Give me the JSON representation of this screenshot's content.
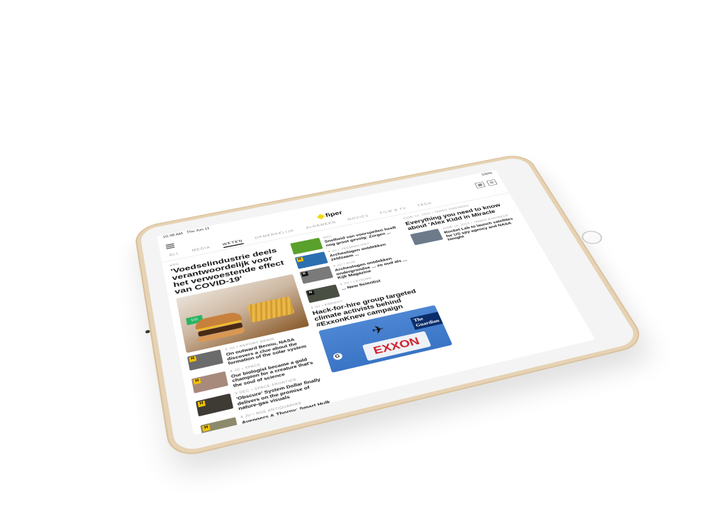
{
  "status": {
    "time": "10:38 AM",
    "date": "Thu Jun 11",
    "battery": "100%"
  },
  "app": {
    "name": "fiper"
  },
  "tabs": [
    {
      "label": "ALL"
    },
    {
      "label": "MEDIA"
    },
    {
      "label": "WETEN",
      "active": true
    },
    {
      "label": "OPMERKELIJK"
    },
    {
      "label": "ALGEMEEN"
    },
    {
      "label": "MOVIES"
    },
    {
      "label": "FILM & TV"
    },
    {
      "label": "TECH"
    }
  ],
  "col1": {
    "featured": {
      "meta": "NRC",
      "headline": "'Voedselindustrie deels verantwoordelijk voor het verwoestende effect van COVID-19'",
      "image": "burger-and-fries-photo"
    },
    "items": [
      {
        "meta": "3 JU • REPORT BRAIN",
        "title": "On outward Bennu, NASA discovers a clue about the formation of the solar system"
      },
      {
        "meta": "4 JU • SPACE",
        "title": "Our biologist became a gold champion for a creature that's the soul of science"
      },
      {
        "meta": "3 DEC • SPACE FRONTIER",
        "title": "'Obscure' System Dollar finally delivers on the promise of nature-gas visuals"
      },
      {
        "meta": "4 JU • NGE ANTIQUARIAN",
        "title": "Avengers & Thorpy: Smart Hulk came up on troubled Cleandia stones"
      }
    ]
  },
  "col2": {
    "items": [
      {
        "meta": "NRC",
        "title": "Snelheid van voorspellen heeft nog groot gevolg: Zorgen ..."
      },
      {
        "meta": "4 JU • TECHNOLOGY",
        "title": "Archeologen ontdekken zeldzaam ..."
      },
      {
        "meta": "4 JU • KIJK",
        "title": "Archeologen ontdekken ondergrondse ... zo oud als ... Kijk Magazine"
      },
      {
        "meta": "4 JU • LEISURE",
        "title": "... New Scientist"
      }
    ],
    "feature": {
      "meta": "4 JU • ENERGY",
      "headline": "Hack-for-hire group targeted climate activists behind #ExxonKnew campaign",
      "source_logo": "The Guardian",
      "sign_text": "EXXON"
    }
  },
  "col3": {
    "meta": "JUNE 10, 2016 • TAMER ENGINEER",
    "headline": "Everything you need to know about 'Alex Kidd in Miracle",
    "items": [
      {
        "meta": "JUNE 10, 2016 • TAMER ENGINEER",
        "title": "Rocket Lab to launch satellites for US spy agency and NASA tonight"
      }
    ]
  }
}
